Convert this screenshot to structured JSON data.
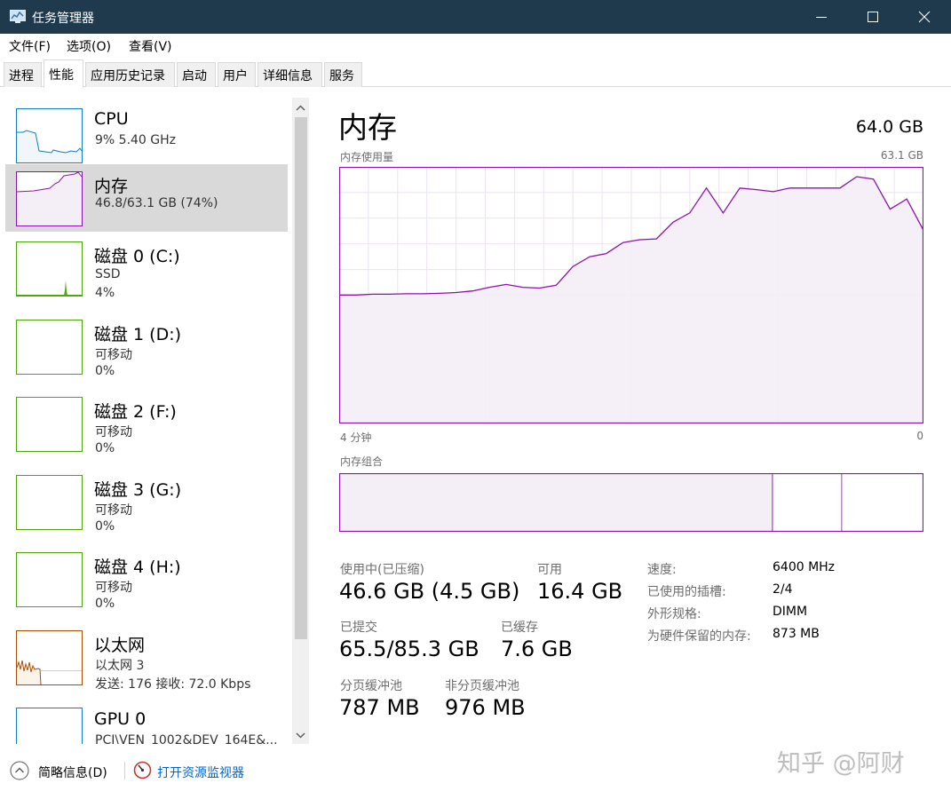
{
  "window": {
    "title": "任务管理器",
    "minimize_icon": "minimize-icon",
    "maximize_icon": "maximize-icon",
    "close_icon": "close-icon"
  },
  "menu": [
    "文件(F)",
    "选项(O)",
    "查看(V)"
  ],
  "tabs": [
    "进程",
    "性能",
    "应用历史记录",
    "启动",
    "用户",
    "详细信息",
    "服务"
  ],
  "active_tab": "性能",
  "sidebar": {
    "items": [
      {
        "name": "CPU",
        "line1": "9%  5.40 GHz",
        "line2": "",
        "color": "#117dbb",
        "selected": false
      },
      {
        "name": "内存",
        "line1": "46.8/63.1 GB (74%)",
        "line2": "",
        "color": "#8b12ae",
        "selected": true
      },
      {
        "name": "磁盘 0 (C:)",
        "line1": "SSD",
        "line2": "4%",
        "color": "#4da60c",
        "selected": false
      },
      {
        "name": "磁盘 1 (D:)",
        "line1": "可移动",
        "line2": "0%",
        "color": "#4da60c",
        "selected": false
      },
      {
        "name": "磁盘 2 (F:)",
        "line1": "可移动",
        "line2": "0%",
        "color": "#4da60c",
        "selected": false
      },
      {
        "name": "磁盘 3 (G:)",
        "line1": "可移动",
        "line2": "0%",
        "color": "#4da60c",
        "selected": false
      },
      {
        "name": "磁盘 4 (H:)",
        "line1": "可移动",
        "line2": "0%",
        "color": "#4da60c",
        "selected": false
      },
      {
        "name": "以太网",
        "line1": "以太网 3",
        "line2": "发送: 176  接收: 72.0 Kbps",
        "color": "#a74f01",
        "selected": false
      },
      {
        "name": "GPU 0",
        "line1": "PCI\\VEN_1002&DEV_164E&...",
        "line2": "",
        "color": "#117dbb",
        "selected": false
      }
    ]
  },
  "main": {
    "title": "内存",
    "total": "64.0 GB",
    "usage_label": "内存使用量",
    "usage_max": "63.1 GB",
    "time_left": "4 分钟",
    "time_right": "0",
    "composition_label": "内存组合",
    "stats": {
      "in_use_label": "使用中(已压缩)",
      "in_use_value": "46.6 GB (4.5 GB)",
      "available_label": "可用",
      "available_value": "16.4 GB",
      "committed_label": "已提交",
      "committed_value": "65.5/85.3 GB",
      "cached_label": "已缓存",
      "cached_value": "7.6 GB",
      "paged_label": "分页缓冲池",
      "paged_value": "787 MB",
      "nonpaged_label": "非分页缓冲池",
      "nonpaged_value": "976 MB"
    },
    "specs": [
      {
        "label": "速度:",
        "value": "6400 MHz"
      },
      {
        "label": "已使用的插槽:",
        "value": "2/4"
      },
      {
        "label": "外形规格:",
        "value": "DIMM"
      },
      {
        "label": "为硬件保留的内存:",
        "value": "873 MB"
      }
    ],
    "accent_color": "#8b12ae",
    "fill_color": "#f4eef7"
  },
  "chart_data": {
    "type": "line",
    "title": "内存使用量",
    "x_range_label": [
      "4 分钟",
      "0"
    ],
    "ylim": [
      0,
      63.1
    ],
    "values": [
      31.6,
      31.6,
      31.8,
      31.8,
      31.9,
      31.9,
      32.0,
      32.2,
      32.6,
      33.5,
      34.2,
      33.5,
      33.3,
      34.0,
      38.6,
      41.0,
      41.8,
      44.5,
      45.2,
      45.4,
      49.5,
      51.8,
      57.9,
      51.8,
      57.9,
      57.5,
      57.0,
      57.9,
      57.9,
      57.9,
      57.9,
      60.7,
      60.1,
      52.7,
      55.2,
      47.5
    ],
    "composition": {
      "in_use_fraction": 0.74,
      "modified_fraction": 0.005,
      "standby_fraction": 0.115,
      "free_fraction": 0.14
    }
  },
  "footer": {
    "collapse_label": "简略信息(D)",
    "resource_monitor_label": "打开资源监视器"
  },
  "watermark": "知乎 @阿财"
}
